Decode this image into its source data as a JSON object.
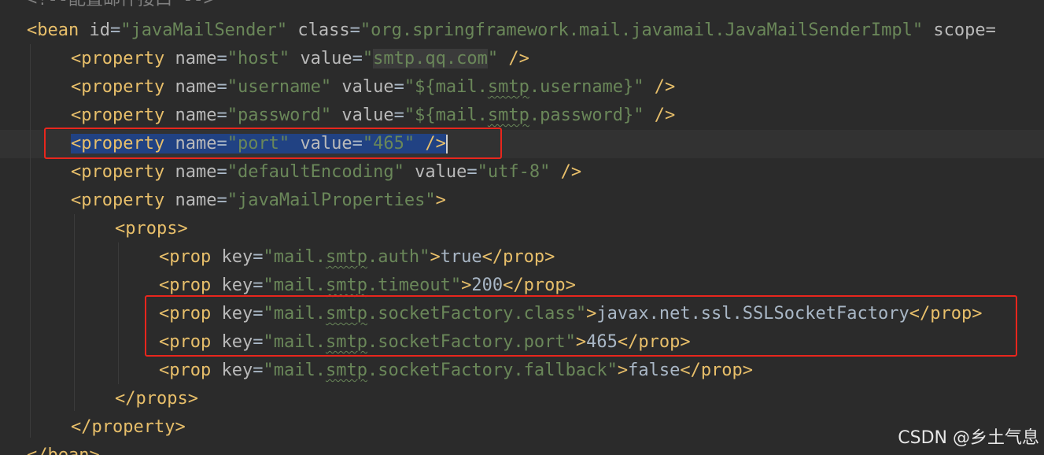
{
  "editor": {
    "language": "XML",
    "caret_line": 5
  },
  "lines": {
    "l0": {
      "comment": "<!--配置邮件接口 -->"
    },
    "l1": {
      "open": "<bean",
      "a1": "id",
      "v1": "\"javaMailSender\"",
      "a2": "class",
      "v2": "\"org.springframework.mail.javamail.JavaMailSenderImpl\"",
      "a3": "scope="
    },
    "l2": {
      "open": "<property",
      "a1": "name",
      "v1": "\"host\"",
      "a2": "value",
      "v2q1": "\"",
      "v2": "smtp.qq.com",
      "v2q2": "\"",
      "close": "/>"
    },
    "l3": {
      "open": "<property",
      "a1": "name",
      "v1": "\"username\"",
      "a2": "value",
      "v2a": "\"${mail.",
      "v2b": "smtp",
      "v2c": ".username}\"",
      "close": "/>"
    },
    "l4": {
      "open": "<property",
      "a1": "name",
      "v1": "\"password\"",
      "a2": "value",
      "v2a": "\"${mail.",
      "v2b": "smtp",
      "v2c": ".password}\"",
      "close": "/>"
    },
    "l5": {
      "open": "<property",
      "a1": "name",
      "v1": "\"port\"",
      "a2": "value",
      "v2": "\"465\"",
      "close": "/>"
    },
    "l6": {
      "open": "<property",
      "a1": "name",
      "v1": "\"defaultEncoding\"",
      "a2": "value",
      "v2": "\"utf-8\"",
      "close": "/>"
    },
    "l7": {
      "open": "<property",
      "a1": "name",
      "v1": "\"javaMailProperties\"",
      "close": ">"
    },
    "l8": {
      "open": "<props>"
    },
    "l9": {
      "open": "<prop",
      "a1": "key",
      "v1a": "\"mail.",
      "v1b": "smtp",
      "v1c": ".auth\"",
      "gt": ">",
      "text": "true",
      "end": "</prop>"
    },
    "l10": {
      "open": "<prop",
      "a1": "key",
      "v1a": "\"mail.",
      "v1b": "smtp",
      "v1c": ".timeout\"",
      "gt": ">",
      "text": "200",
      "end": "</prop>"
    },
    "l11": {
      "open": "<prop",
      "a1": "key",
      "v1a": "\"mail.",
      "v1b": "smtp",
      "v1c": ".socketFactory.class\"",
      "gt": ">",
      "text": "javax.net.ssl.SSLSocketFactory",
      "end": "</prop>"
    },
    "l12": {
      "open": "<prop",
      "a1": "key",
      "v1a": "\"mail.",
      "v1b": "smtp",
      "v1c": ".socketFactory.port\"",
      "gt": ">",
      "text": "465",
      "end": "</prop>"
    },
    "l13": {
      "open": "<prop",
      "a1": "key",
      "v1a": "\"mail.",
      "v1b": "smtp",
      "v1c": ".socketFactory.fallback\"",
      "gt": ">",
      "text": "false",
      "end": "</prop>"
    },
    "l14": {
      "close": "</props>"
    },
    "l15": {
      "close": "</property>"
    },
    "l16": {
      "close": "</bean>"
    }
  },
  "colors": {
    "background": "#2b2b2b",
    "tag": "#e8bf6a",
    "attribute": "#bababa",
    "value": "#6a8759",
    "text": "#a9b7c6",
    "selection": "#214283",
    "annotation": "#e8261d"
  },
  "watermark": "CSDN @乡土气息"
}
